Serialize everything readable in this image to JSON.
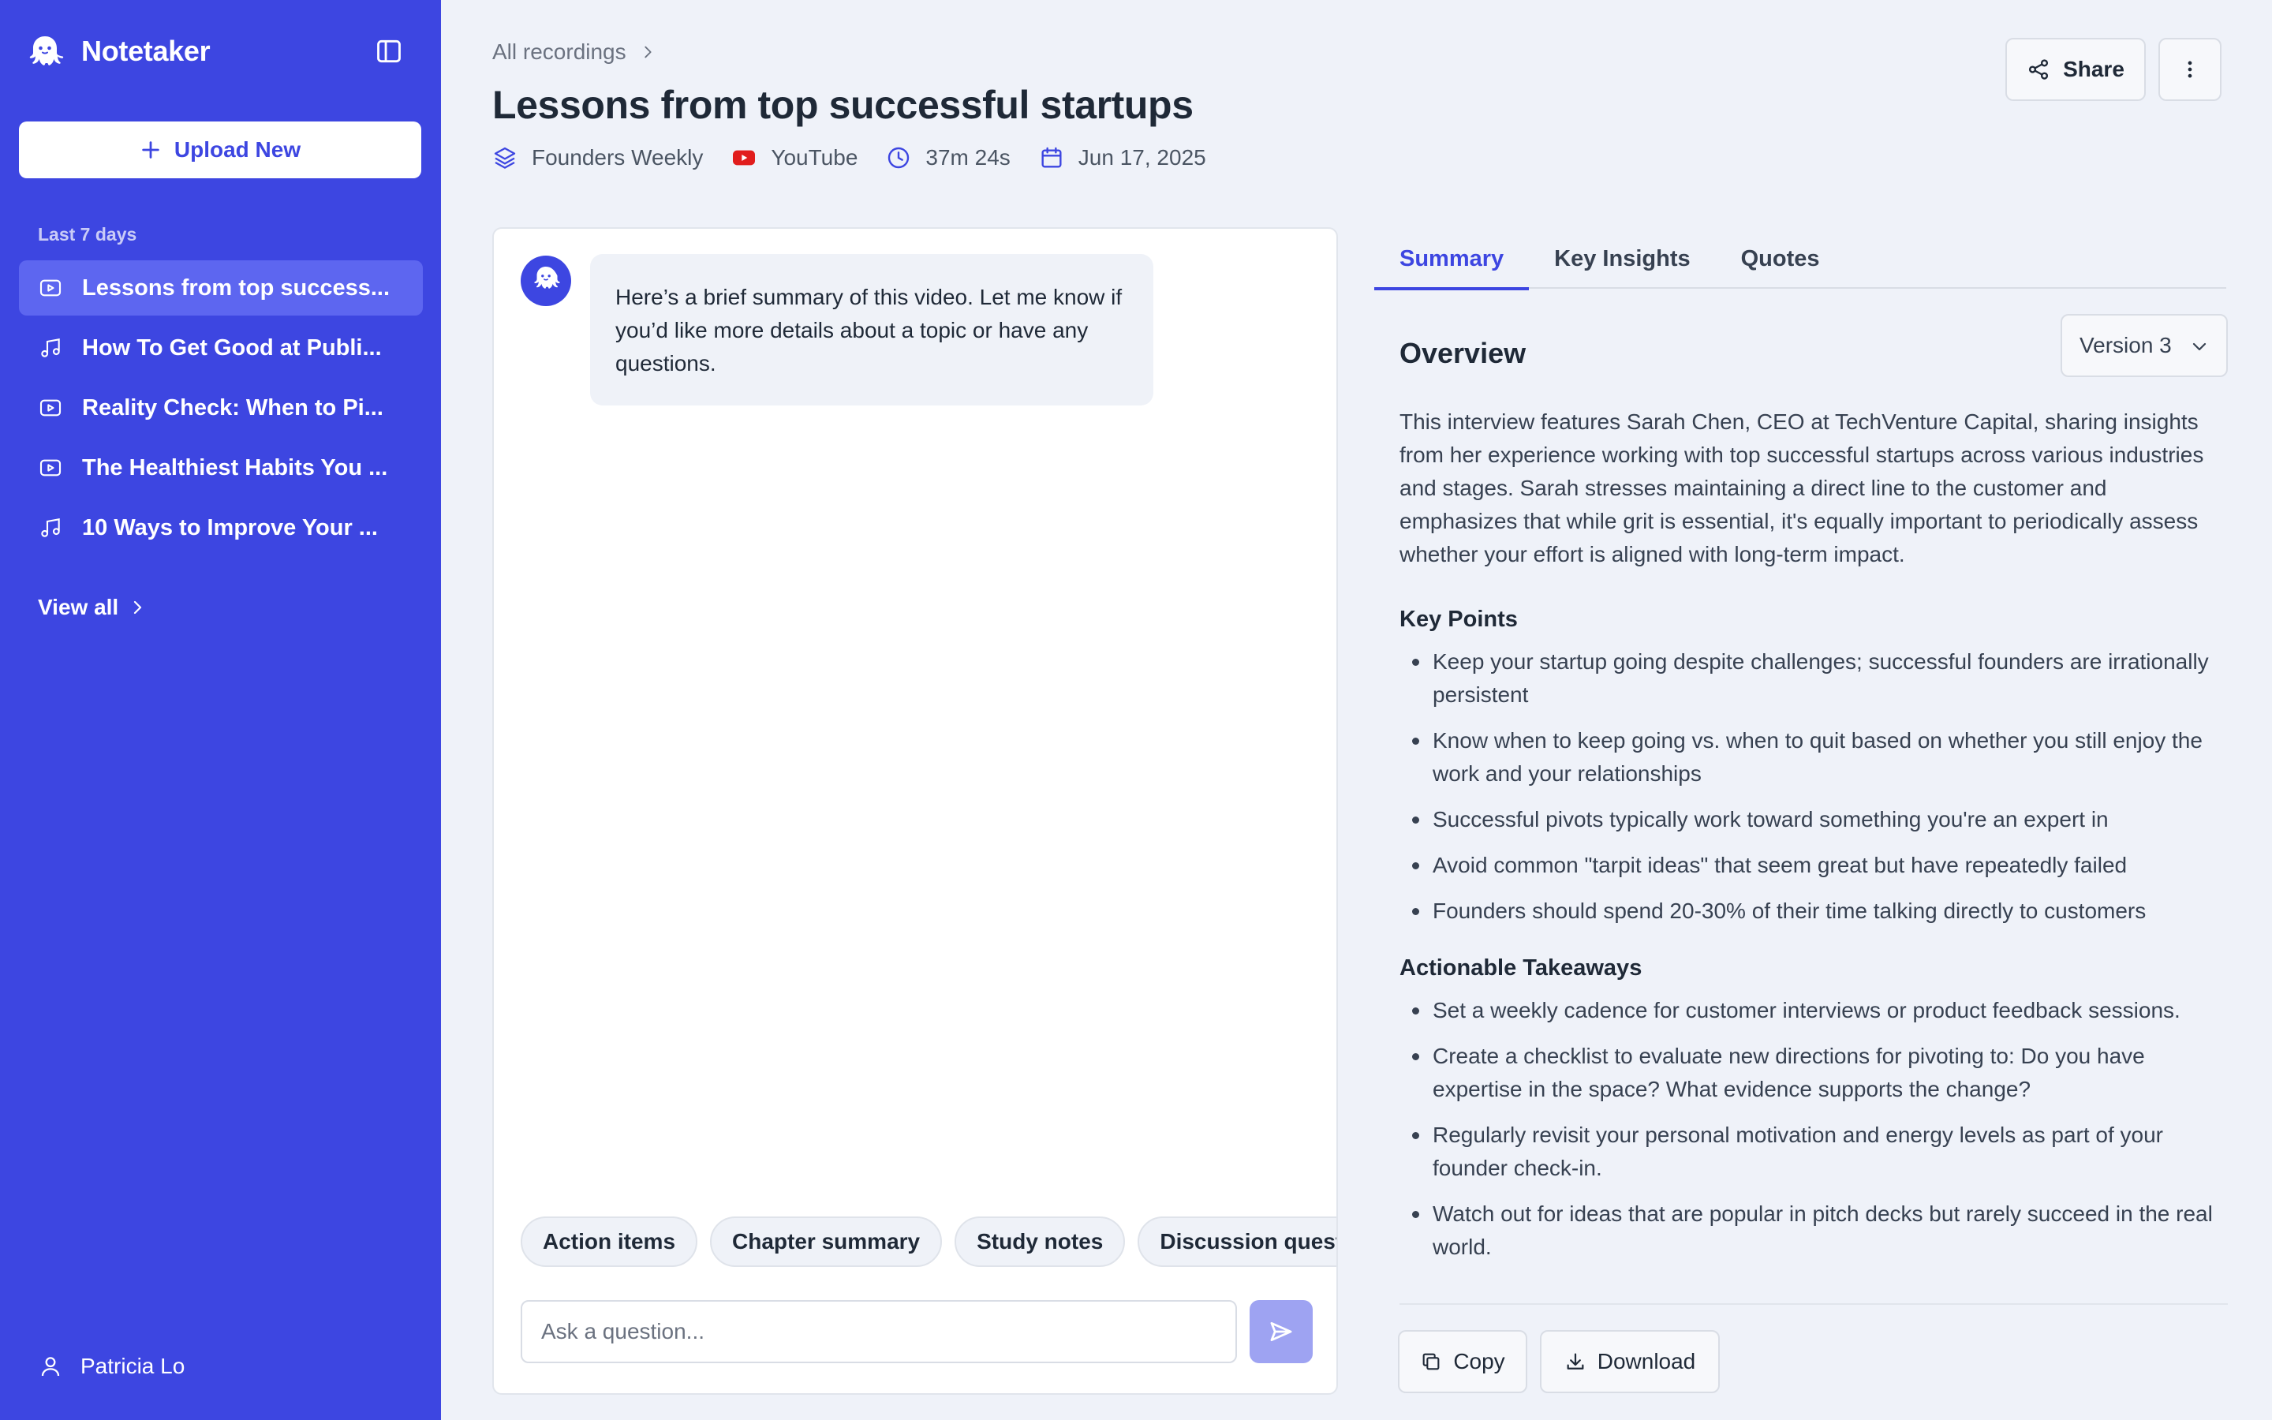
{
  "app": {
    "name": "Notetaker"
  },
  "sidebar": {
    "upload_label": "Upload New",
    "section_label": "Last 7 days",
    "items": [
      {
        "title": "Lessons from top success...",
        "icon": "video-icon",
        "active": true
      },
      {
        "title": "How To Get Good at Publi...",
        "icon": "music-note-icon",
        "active": false
      },
      {
        "title": "Reality Check: When to Pi...",
        "icon": "video-icon",
        "active": false
      },
      {
        "title": "The Healthiest Habits You ...",
        "icon": "video-icon",
        "active": false
      },
      {
        "title": "10 Ways to Improve Your ...",
        "icon": "music-note-icon",
        "active": false
      }
    ],
    "view_all_label": "View all",
    "user_name": "Patricia Lo"
  },
  "header": {
    "breadcrumb": "All recordings",
    "title": "Lessons from top successful startups",
    "meta": {
      "channel": "Founders Weekly",
      "source": "YouTube",
      "duration": "37m 24s",
      "date": "Jun 17, 2025"
    },
    "share_label": "Share"
  },
  "chat": {
    "bot_message": "Here’s a brief summary of this video. Let me know if you’d like more details about a topic or have any questions.",
    "chips": [
      "Action items",
      "Chapter summary",
      "Study notes",
      "Discussion questions"
    ],
    "input_placeholder": "Ask a question..."
  },
  "panel": {
    "tabs": [
      "Summary",
      "Key Insights",
      "Quotes"
    ],
    "version": "Version 3",
    "overview_heading": "Overview",
    "overview_text": "This interview features Sarah Chen, CEO at TechVenture Capital, sharing insights from her experience working with top successful startups across various industries and stages. Sarah stresses maintaining a direct line to the customer and emphasizes that while grit is essential, it's equally important to periodically assess whether your effort is aligned with long-term impact.",
    "key_points_heading": "Key Points",
    "key_points": [
      "Keep your startup going despite challenges; successful founders are irrationally persistent",
      "Know when to keep going vs. when to quit based on whether you still enjoy the work and your relationships",
      "Successful pivots typically work toward something you're an expert in",
      "Avoid common \"tarpit ideas\" that seem great but have repeatedly failed",
      "Founders should spend 20-30% of their time talking directly to customers"
    ],
    "takeaways_heading": "Actionable Takeaways",
    "takeaways": [
      "Set a weekly cadence for customer interviews or product feedback sessions.",
      "Create a checklist to evaluate new directions for pivoting to: Do you have expertise in the space? What evidence supports the change?",
      "Regularly revisit your personal motivation and energy levels as part of your founder check-in.",
      "Watch out for ideas that are popular in pitch decks but rarely succeed in the real world."
    ],
    "copy_label": "Copy",
    "download_label": "Download"
  },
  "colors": {
    "sidebar_bg": "#3d46e1",
    "accent": "#3d46e1",
    "youtube_red": "#e11d1d",
    "send_button": "#9ea3f2"
  }
}
